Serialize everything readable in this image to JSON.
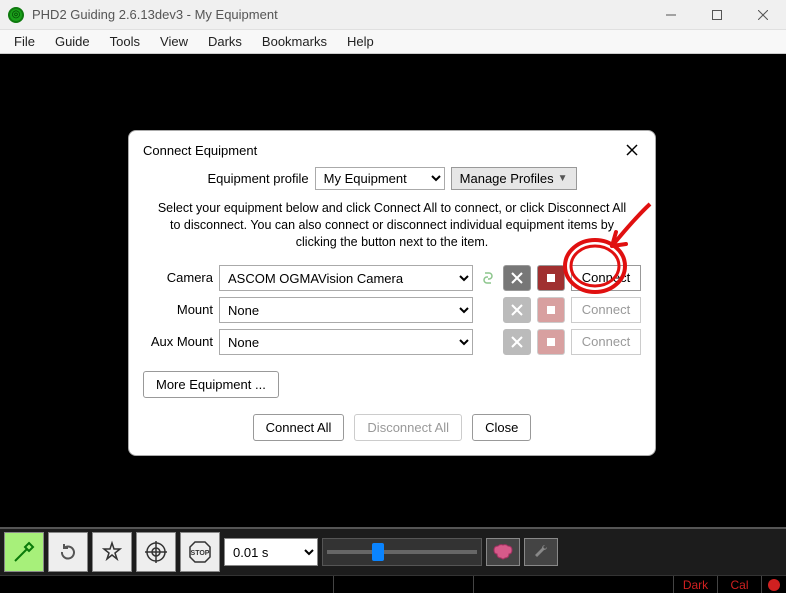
{
  "titlebar": {
    "title": "PHD2 Guiding 2.6.13dev3 - My Equipment"
  },
  "menu": [
    "File",
    "Guide",
    "Tools",
    "View",
    "Darks",
    "Bookmarks",
    "Help"
  ],
  "dialog": {
    "title": "Connect Equipment",
    "profile_label": "Equipment profile",
    "profile_value": "My Equipment",
    "manage_label": "Manage Profiles",
    "instructions": "Select your equipment below and click Connect All to connect, or click Disconnect All to disconnect. You can also connect or disconnect individual equipment items by clicking the button next to the item.",
    "rows": {
      "camera": {
        "label": "Camera",
        "value": "ASCOM OGMAVision Camera",
        "connect": "Connect"
      },
      "mount": {
        "label": "Mount",
        "value": "None",
        "connect": "Connect"
      },
      "aux": {
        "label": "Aux Mount",
        "value": "None",
        "connect": "Connect"
      }
    },
    "more": "More Equipment ...",
    "connect_all": "Connect All",
    "disconnect_all": "Disconnect All",
    "close": "Close"
  },
  "toolbar": {
    "exposure": "0.01 s"
  },
  "status": {
    "dark": "Dark",
    "cal": "Cal"
  }
}
